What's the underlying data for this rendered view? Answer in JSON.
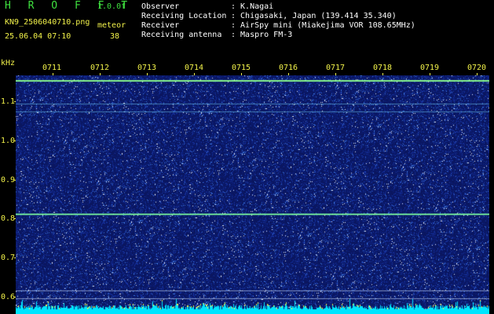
{
  "header": {
    "logo": "H R O F F T",
    "version": "1.0.0f",
    "filename": "KN9_2506040710.png",
    "datetime": "25.06.04 07:10",
    "meteor_label": "meteor",
    "meteor_count": "38",
    "info": [
      {
        "label": "Observer",
        "value": ": K.Nagai"
      },
      {
        "label": "Receiving Location",
        "value": ": Chigasaki, Japan (139.414 35.340)"
      },
      {
        "label": "Receiver",
        "value": ": AirSpy mini (Miakejima VOR 108.65MHz)"
      },
      {
        "label": "Receiving antenna",
        "value": ": Maspro FM-3"
      }
    ]
  },
  "axis": {
    "unit": "kHz",
    "y_ticks": [
      "1.1",
      "1.0",
      "0.9",
      "0.8",
      "0.7",
      "0.6"
    ],
    "x_ticks": [
      "0711",
      "0712",
      "0713",
      "0714",
      "0715",
      "0716",
      "0717",
      "0718",
      "0719",
      "0720"
    ]
  },
  "colors": {
    "background": "#000000",
    "axis_text": "#f2f24a",
    "header_green": "#3fe03f",
    "spectrogram_bg": "#0a1660",
    "noise_band": "#00e5ff",
    "signal_line": "#7cff7c"
  }
}
